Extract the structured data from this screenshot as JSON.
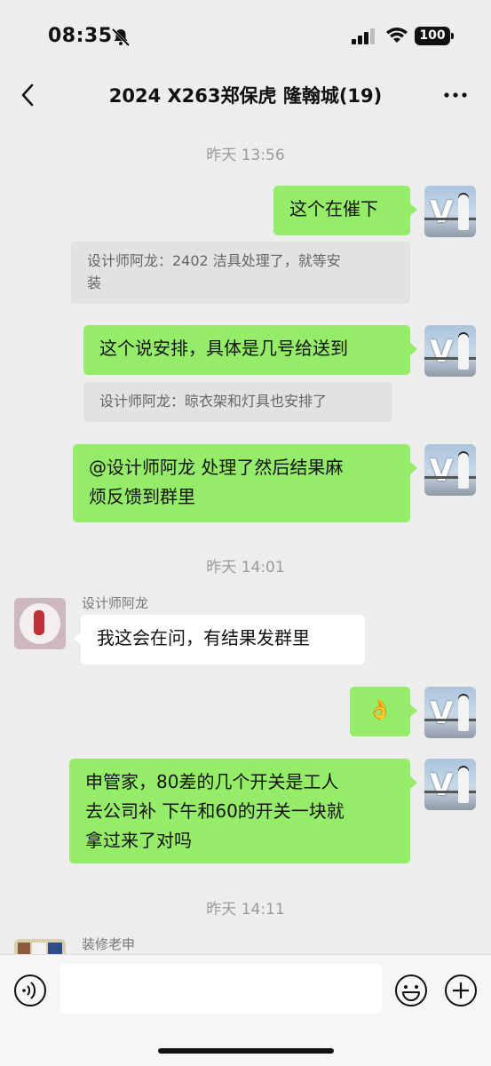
{
  "status_bar": {
    "time": "08:35",
    "battery": "100"
  },
  "header": {
    "title": "2024 X263郑保虎 隆翰城(19)"
  },
  "messages": {
    "ts1": "昨天 13:56",
    "m1": "这个在催下",
    "q1_line1": "设计师阿龙：2402 洁具处理了，就等安",
    "q1_line2": "装",
    "m2": "这个说安排，具体是几号给送到",
    "q2": "设计师阿龙：晾衣架和灯具也安排了",
    "m3_line1": "@设计师阿龙  处理了然后结果麻",
    "m3_line2": "烦反馈到群里",
    "ts2": "昨天 14:01",
    "sender1": "设计师阿龙",
    "m4": "我这会在问，有结果发群里",
    "m5": "👌",
    "m6_line1": "申管家，80差的几个开关是工人",
    "m6_line2": "去公司补 下午和60的开关一块就",
    "m6_line3": "拿过来了对吗",
    "ts3": "昨天 14:11",
    "sender2": "装修老申"
  },
  "colors": {
    "background": "#ededed",
    "out_bubble": "#95ec69",
    "in_bubble": "#ffffff"
  },
  "icons": [
    "bell-muted-icon",
    "signal-icon",
    "wifi-icon",
    "battery-icon",
    "back-icon",
    "more-icon",
    "voice-icon",
    "emoji-icon",
    "plus-icon"
  ]
}
